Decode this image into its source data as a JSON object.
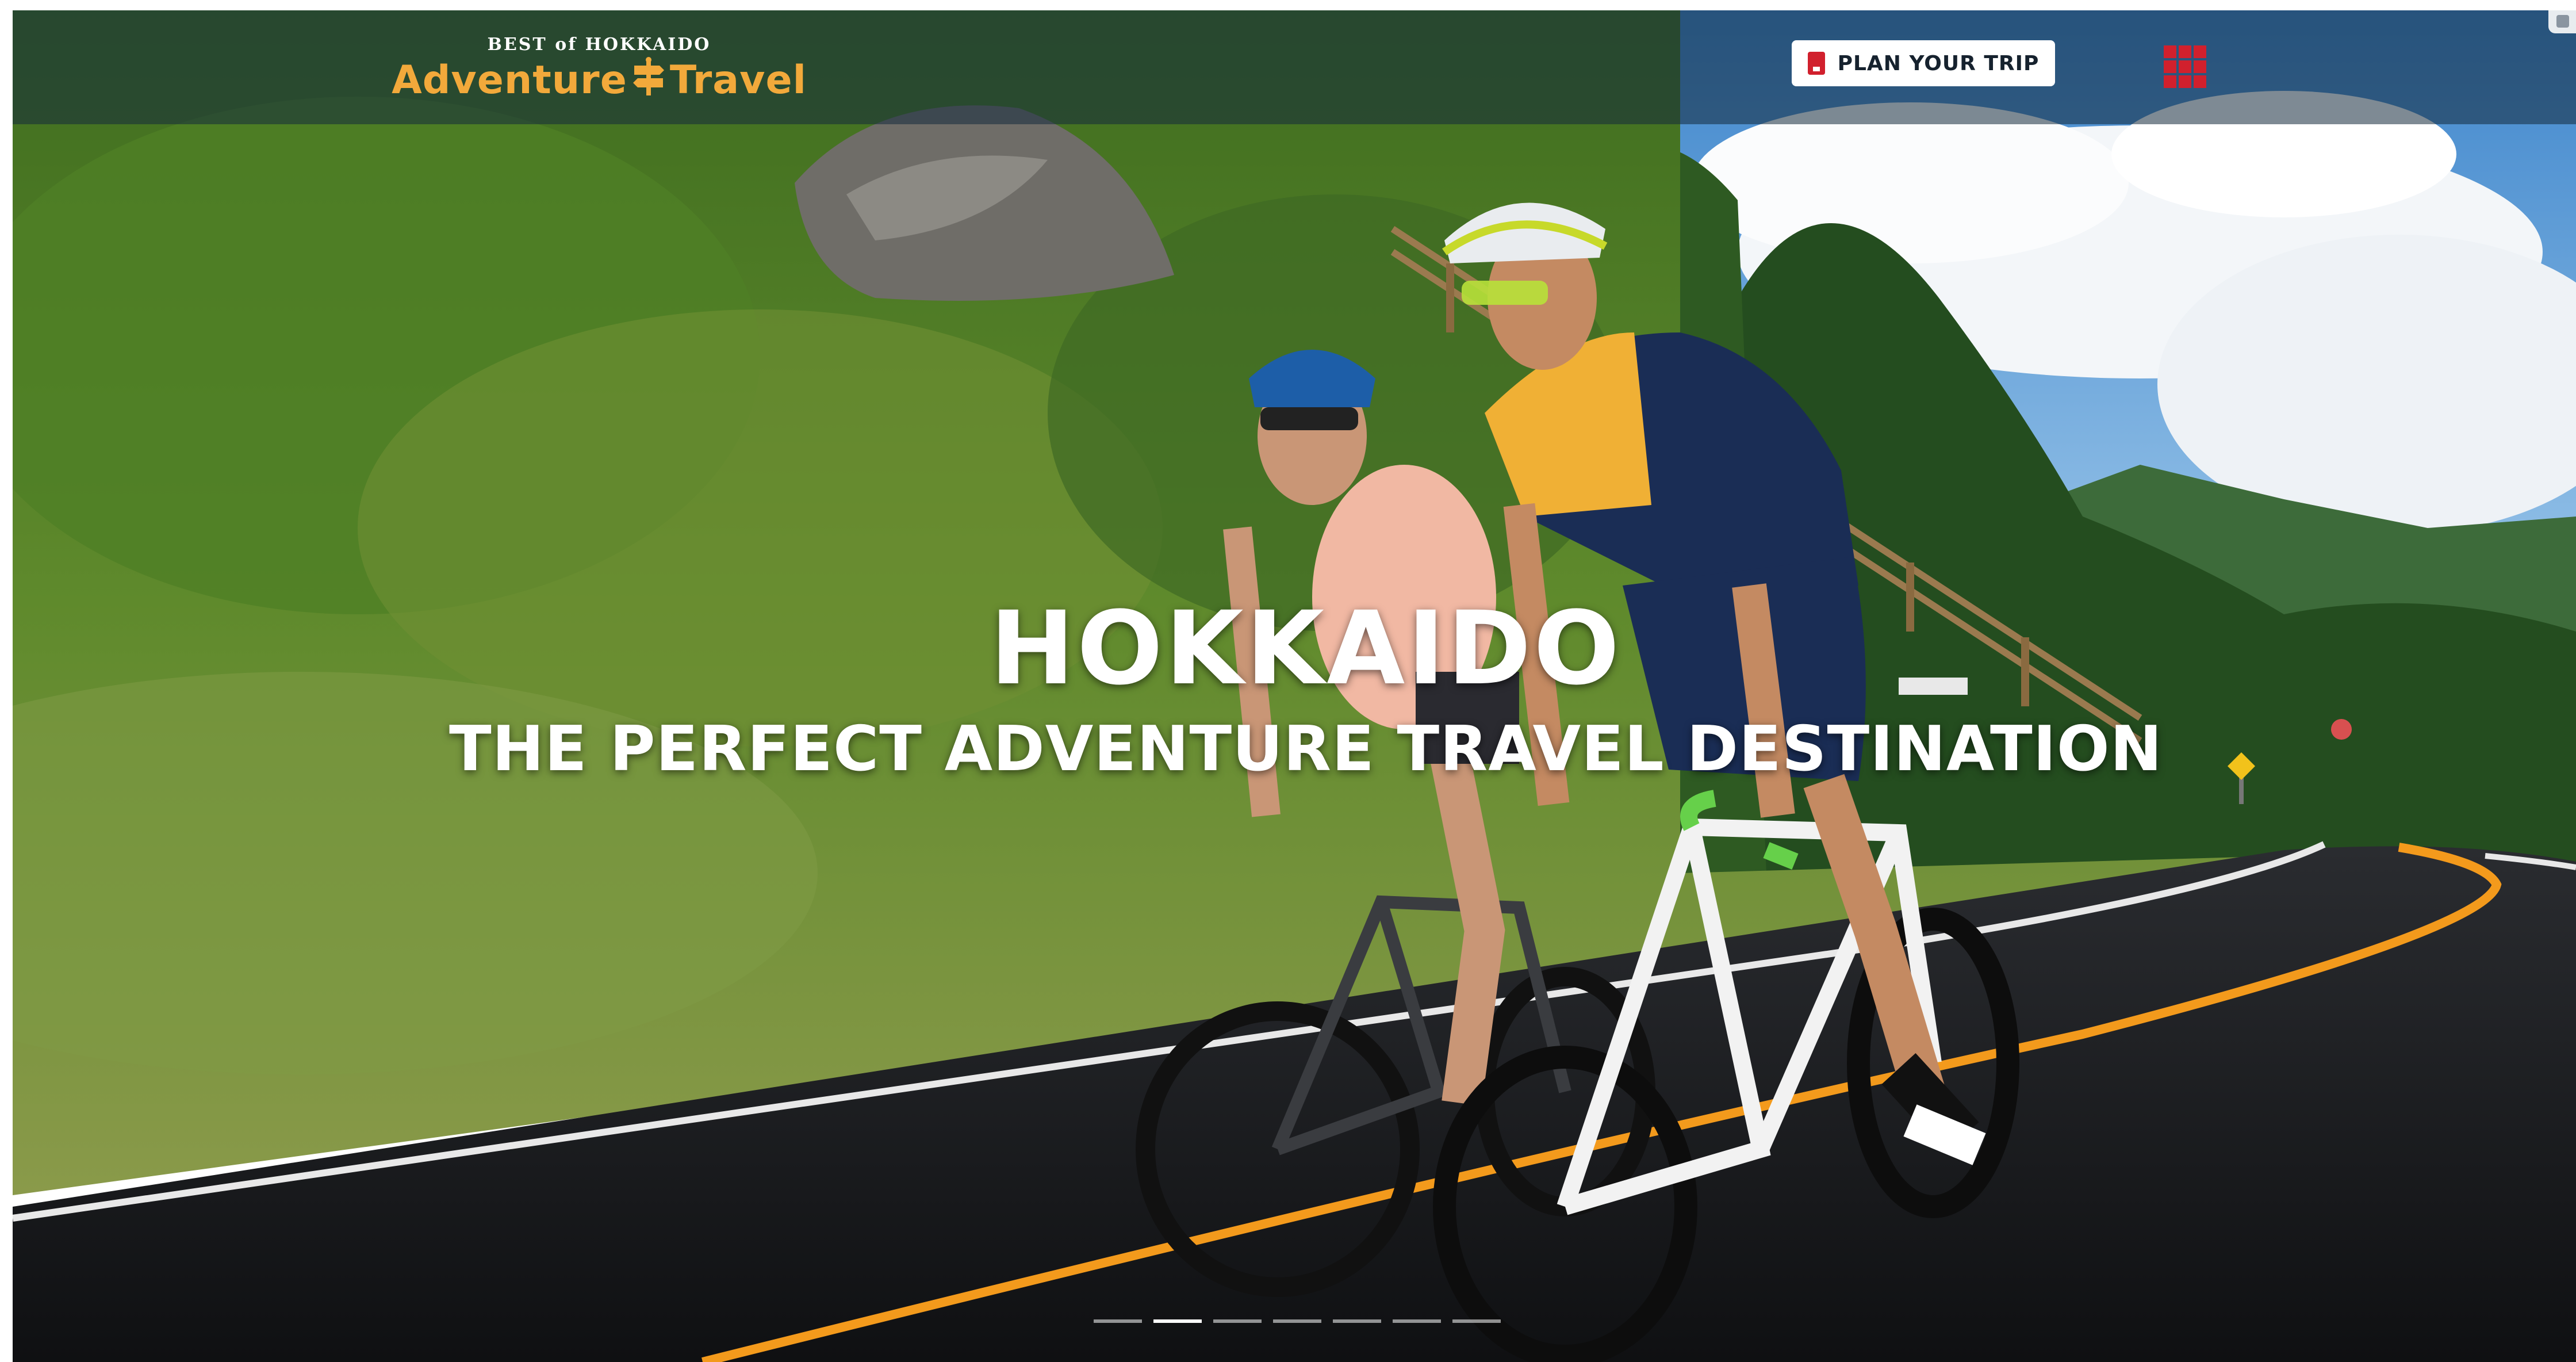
{
  "header": {
    "logo_top": "BEST of HOKKAIDO",
    "logo_word_left": "Adventure",
    "logo_word_right": "Travel",
    "plan_button_label": "PLAN YOUR TRIP",
    "menu_icon": "grid-menu-icon",
    "plan_icon": "guidebook-icon"
  },
  "hero": {
    "title": "HOKKAIDO",
    "subtitle": "THE PERFECT ADVENTURE TRAVEL DESTINATION",
    "slide_count": 7,
    "active_slide": 2
  },
  "colors": {
    "logo_accent": "#f2a93b",
    "menu_red": "#d1202d",
    "header_overlay": "#142a3c"
  }
}
